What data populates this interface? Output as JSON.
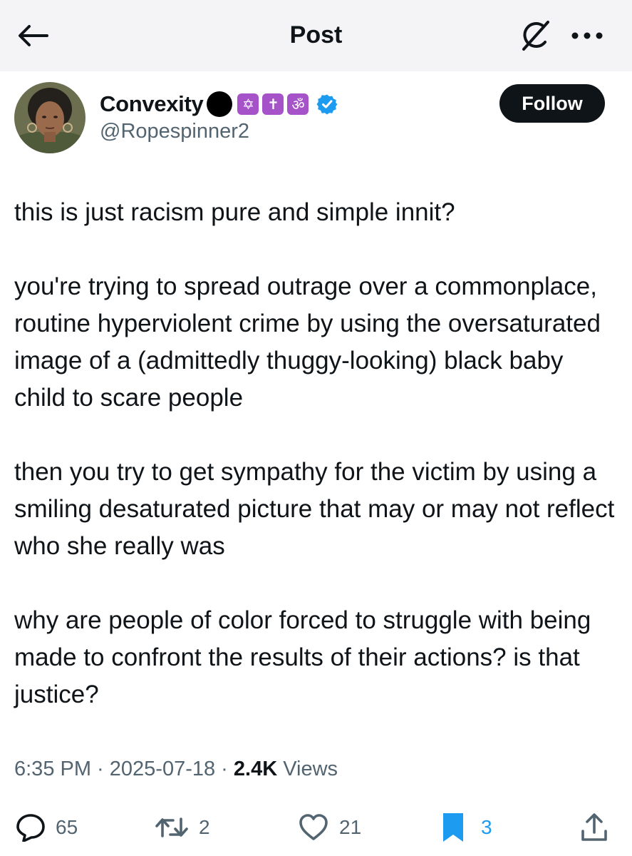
{
  "header": {
    "title": "Post",
    "back_icon": "arrow-left-icon",
    "grok_icon": "grok-icon",
    "more_icon": "ellipsis-icon"
  },
  "author": {
    "display_name": "Convexity",
    "name_emojis": [
      "black-circle",
      "star-of-david",
      "latin-cross",
      "om-symbol"
    ],
    "emoji_glyphs": {
      "star": "✡",
      "cross": "✝",
      "om": "ॐ"
    },
    "emoji_bg_color": "#a653c9",
    "verified": true,
    "verified_color": "#1d9bf0",
    "handle": "@Ropespinner2",
    "follow_label": "Follow"
  },
  "post": {
    "paragraphs": [
      "this is just racism pure and simple innit?",
      "you're trying to spread outrage over a commonplace, routine hyperviolent crime by using the oversaturated image of a (admittedly thuggy-looking) black baby child to scare people",
      "then you try to get sympathy for the victim by using a smiling desaturated picture that may or may not reflect who she really was",
      "why are people of color forced to struggle with being made to confront the results of their actions? is that justice?"
    ],
    "time": "6:35 PM",
    "separator": " · ",
    "date": "2025-07-18",
    "views_count": "2.4K",
    "views_label": " Views"
  },
  "actions": {
    "replies": "65",
    "reposts": "2",
    "likes": "21",
    "bookmarks": "3",
    "bookmark_color": "#1d9bf0"
  }
}
